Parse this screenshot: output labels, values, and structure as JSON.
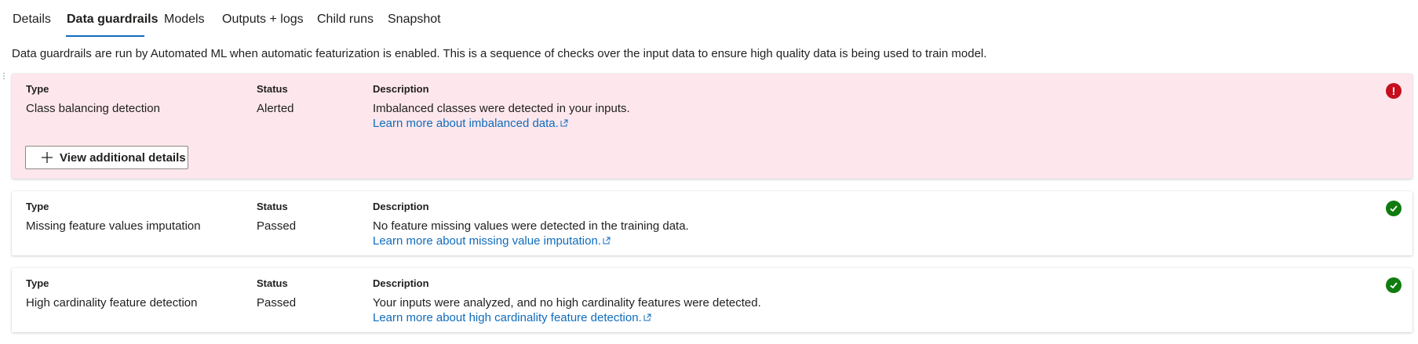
{
  "tabs": [
    {
      "label": "Details"
    },
    {
      "label": "Data guardrails",
      "active": true
    },
    {
      "label": "Models"
    },
    {
      "label": "Outputs + logs"
    },
    {
      "label": "Child runs"
    },
    {
      "label": "Snapshot"
    }
  ],
  "intro": "Data guardrails are run by Automated ML when automatic featurization is enabled. This is a sequence of checks over the input data to ensure high quality data is being used to train model.",
  "columns": {
    "type": "Type",
    "status": "Status",
    "description": "Description"
  },
  "guardrails": [
    {
      "type": "Class balancing detection",
      "status": "Alerted",
      "description": "Imbalanced classes were detected in your inputs.",
      "link": "Learn more about imbalanced data.",
      "icon": "error-icon",
      "button": "View additional details"
    },
    {
      "type": "Missing feature values imputation",
      "status": "Passed",
      "description": "No feature missing values were detected in the training data.",
      "link": "Learn more about missing value imputation.",
      "icon": "check-icon"
    },
    {
      "type": "High cardinality feature detection",
      "status": "Passed",
      "description": "Your inputs were analyzed, and no high cardinality features were detected.",
      "link": "Learn more about high cardinality feature detection.",
      "icon": "check-icon"
    }
  ],
  "colors": {
    "accent": "#0f6cbd",
    "alert_bg": "#fde7ec",
    "error": "#c50f1f",
    "success": "#107c10"
  }
}
